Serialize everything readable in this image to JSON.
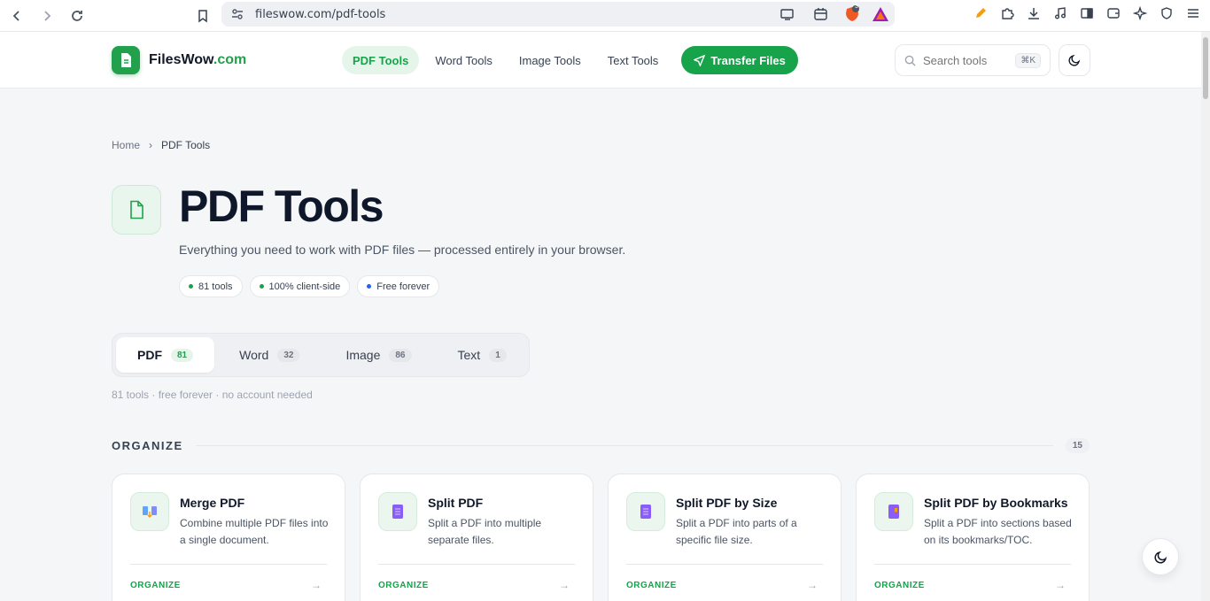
{
  "browser": {
    "url": "fileswow.com/pdf-tools",
    "brave_badge": "3"
  },
  "header": {
    "logo_name": "FilesWow",
    "logo_tld": ".com",
    "nav": [
      {
        "label": "PDF Tools"
      },
      {
        "label": "Word Tools"
      },
      {
        "label": "Image Tools"
      },
      {
        "label": "Text Tools"
      }
    ],
    "transfer_label": "Transfer Files",
    "search_placeholder": "Search tools",
    "search_shortcut": "⌘K"
  },
  "breadcrumb": {
    "home": "Home",
    "separator": "›",
    "current": "PDF Tools"
  },
  "hero": {
    "title": "PDF Tools",
    "subtitle": "Everything you need to work with PDF files — processed entirely in your browser.",
    "pills": [
      {
        "label": "81 tools",
        "color": "#16a34a"
      },
      {
        "label": "100% client-side",
        "color": "#16a34a"
      },
      {
        "label": "Free forever",
        "color": "#2563eb"
      }
    ]
  },
  "tabs": [
    {
      "label": "PDF",
      "count": "81"
    },
    {
      "label": "Word",
      "count": "32"
    },
    {
      "label": "Image",
      "count": "86"
    },
    {
      "label": "Text",
      "count": "1"
    }
  ],
  "tabs_meta": "81 tools · free forever · no account needed",
  "section": {
    "title": "ORGANIZE",
    "count": "15"
  },
  "cards": [
    {
      "title": "Merge PDF",
      "desc": "Combine multiple PDF files into a single document.",
      "tag": "ORGANIZE",
      "arrow": "→",
      "icon": "merge-icon"
    },
    {
      "title": "Split PDF",
      "desc": "Split a PDF into multiple separate files.",
      "tag": "ORGANIZE",
      "arrow": "→",
      "icon": "split-icon"
    },
    {
      "title": "Split PDF by Size",
      "desc": "Split a PDF into parts of a specific file size.",
      "tag": "ORGANIZE",
      "arrow": "→",
      "icon": "split-size-icon"
    },
    {
      "title": "Split PDF by Bookmarks",
      "desc": "Split a PDF into sections based on its bookmarks/TOC.",
      "tag": "ORGANIZE",
      "arrow": "→",
      "icon": "split-bookmarks-icon"
    }
  ],
  "colors": {
    "brand": "#16a34a",
    "brand_light": "#e6f5ea"
  }
}
